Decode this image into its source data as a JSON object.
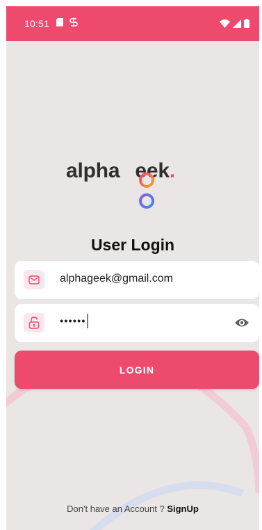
{
  "status_bar": {
    "time": "10:51",
    "background": "#ee4a6e"
  },
  "logo": {
    "text_before": "alpha",
    "text_after": "eek",
    "dot": ".",
    "brand_color": "#ee4a6e"
  },
  "page": {
    "title": "User Login"
  },
  "form": {
    "email": {
      "value": "alphageek@gmail.com",
      "icon": "mail-icon"
    },
    "password": {
      "value": "••••••",
      "icon": "lock-icon",
      "toggle_icon": "eye-icon"
    },
    "login_label": "LOGIN"
  },
  "footer": {
    "prompt": "Don't have an Account ? ",
    "signup_label": "SignUp"
  },
  "colors": {
    "accent": "#ee4a6e",
    "background": "#ebe6e6",
    "field_background": "#ffffff",
    "icon_tint_background": "#fde6ec"
  }
}
